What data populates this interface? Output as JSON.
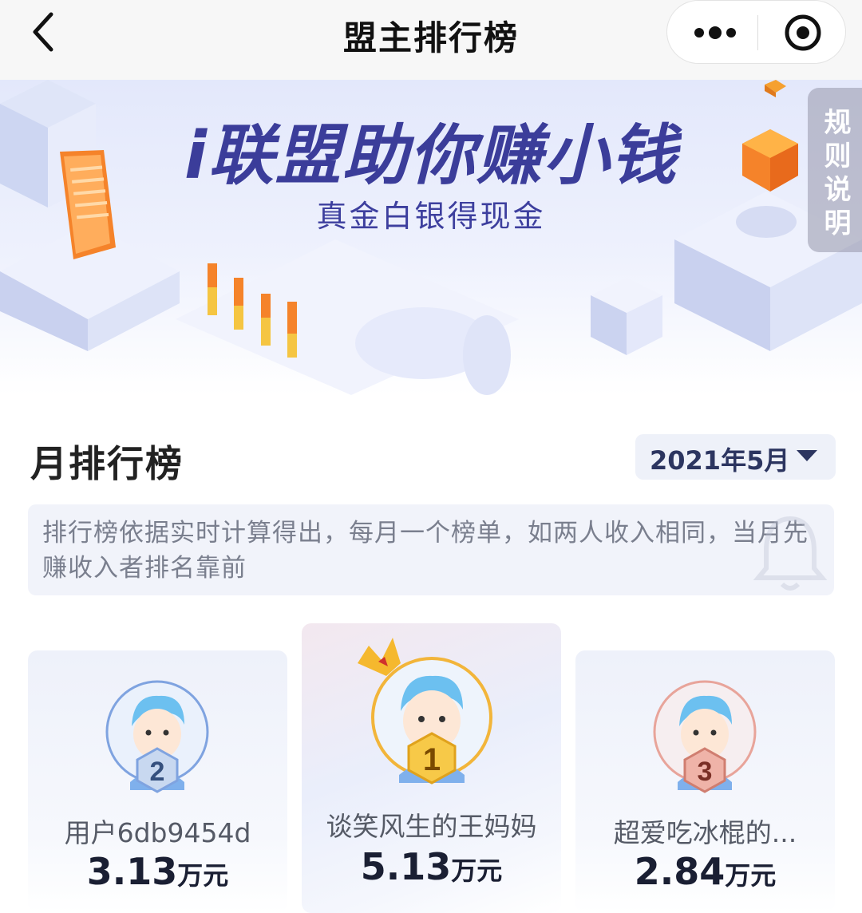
{
  "nav": {
    "title": "盟主排行榜",
    "back_icon": "chevron-left-icon",
    "more_icon": "more-dots-icon",
    "close_icon": "target-close-icon"
  },
  "banner": {
    "title": "i联盟助你赚小钱",
    "subtitle": "真金白银得现金",
    "rules_label": "规则说明"
  },
  "section": {
    "title": "月排行榜",
    "month_value": "2021年5月"
  },
  "notice": {
    "text": "排行榜依据实时计算得出，每月一个榜单，如两人收入相同，当月先赚收入者排名靠前"
  },
  "podium": [
    {
      "rank": "2",
      "name": "用户6db9454d",
      "amount": "3.13",
      "unit": "万元",
      "ring_color": "#7fa3e0"
    },
    {
      "rank": "1",
      "name": "谈笑风生的王妈妈",
      "amount": "5.13",
      "unit": "万元",
      "ring_color": "#f2b53a"
    },
    {
      "rank": "3",
      "name": "超爱吃冰棍的...",
      "amount": "2.84",
      "unit": "万元",
      "ring_color": "#e8a49a"
    }
  ],
  "colors": {
    "banner_title": "#3b3d9a",
    "accent_gold": "#f2b53a",
    "accent_orange": "#f5832a"
  }
}
